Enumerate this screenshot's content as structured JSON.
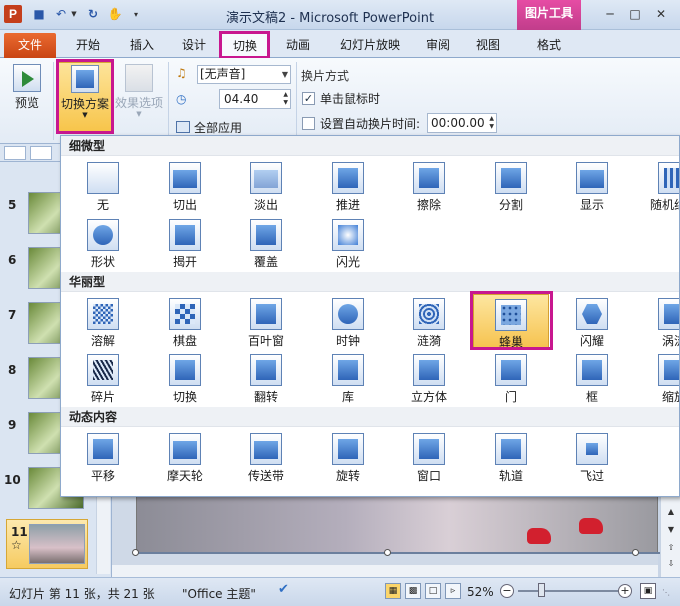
{
  "titlebar": {
    "app_logo": "P",
    "title": "演示文稿2 - Microsoft PowerPoint",
    "context_group": "图片工具",
    "icons": {
      "save": "save-icon",
      "undo": "undo-icon",
      "redo": "redo-icon",
      "touch": "touch-mode-icon"
    }
  },
  "tabs": {
    "file": "文件",
    "home": "开始",
    "insert": "插入",
    "design": "设计",
    "transitions": "切换",
    "animations": "动画",
    "slideshow": "幻灯片放映",
    "review": "审阅",
    "view": "视图",
    "format": "格式"
  },
  "ribbon": {
    "preview_label": "预览",
    "preview_group": "预览",
    "scheme_label": "切换方案",
    "effects_label": "效果选项",
    "sound_value": "[无声音]",
    "duration_value": "04.40",
    "apply_all": "全部应用",
    "switch_mode_title": "换片方式",
    "on_click_label": "单击鼠标时",
    "on_click_checked": true,
    "auto_label": "设置自动换片时间:",
    "auto_checked": false,
    "auto_time": "00:00.00"
  },
  "gallery": {
    "sections": {
      "subtle": "细微型",
      "exciting": "华丽型",
      "dynamic": "动态内容"
    },
    "subtle": [
      "无",
      "切出",
      "淡出",
      "推进",
      "擦除",
      "分割",
      "显示",
      "随机线条",
      "形状",
      "揭开",
      "覆盖",
      "闪光"
    ],
    "exciting": [
      "溶解",
      "棋盘",
      "百叶窗",
      "时钟",
      "涟漪",
      "蜂巢",
      "闪耀",
      "涡流",
      "碎片",
      "切换",
      "翻转",
      "库",
      "立方体",
      "门",
      "框",
      "缩放"
    ],
    "dynamic": [
      "平移",
      "摩天轮",
      "传送带",
      "旋转",
      "窗口",
      "轨道",
      "飞过"
    ],
    "selected": "蜂巢"
  },
  "slides": {
    "numbers": [
      "5",
      "6",
      "7",
      "8",
      "9",
      "10"
    ],
    "current_num": "11",
    "current_star": "☆"
  },
  "status": {
    "slide_info": "幻灯片 第 11 张，共 21 张",
    "theme": "\"Office 主题\"",
    "zoom": "52%"
  },
  "colors": {
    "accent_highlight": "#c8178f",
    "file_tab": "#d54b18",
    "selected_item": "#f6c24d"
  }
}
